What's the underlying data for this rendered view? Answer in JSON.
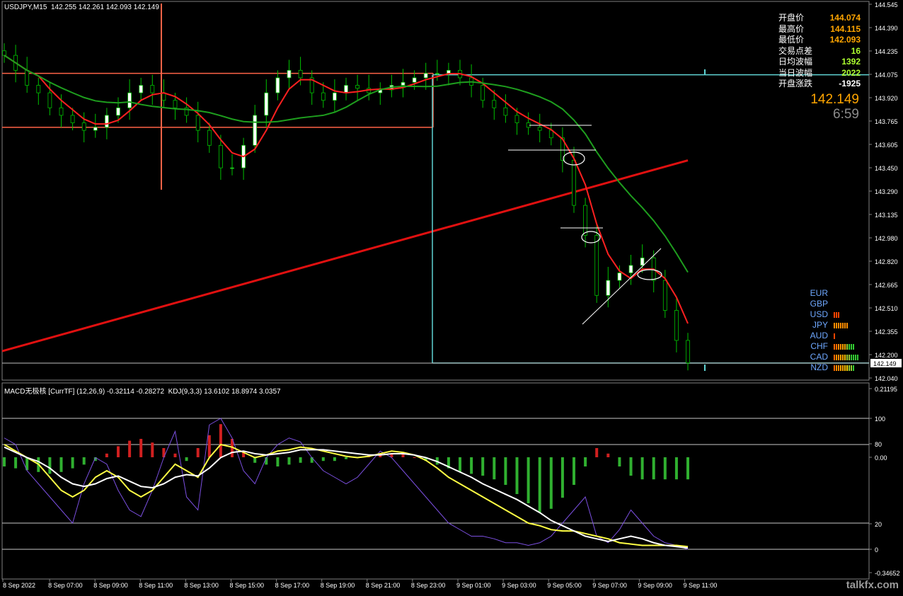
{
  "header": {
    "symbol_line": "USDJPY,M15  142.255 142.261 142.093 142.149"
  },
  "hud": {
    "rows": [
      {
        "key": "开盘价",
        "value": "144.074",
        "color": "#ffa500"
      },
      {
        "key": "最高价",
        "value": "144.115",
        "color": "#ffa500"
      },
      {
        "key": "最低价",
        "value": "142.093",
        "color": "#ffa500"
      },
      {
        "key": "交易点差",
        "value": "16",
        "color": "#adff2f"
      },
      {
        "key": "日均波幅",
        "value": "1392",
        "color": "#adff2f"
      },
      {
        "key": "当日波幅",
        "value": "2022",
        "color": "#adff2f"
      },
      {
        "key": "开盘涨跌",
        "value": "-1925",
        "color": "#ffffff"
      }
    ],
    "big_price": "142.149",
    "timer": "6:59"
  },
  "currency_strength": [
    {
      "name": "EUR",
      "bars": []
    },
    {
      "name": "GBP",
      "bars": []
    },
    {
      "name": "USD",
      "bars": [
        "#ff4500",
        "#ff4500",
        "#ff4500"
      ]
    },
    {
      "name": "JPY",
      "bars": [
        "#ff8c00",
        "#ff8c00",
        "#ff8c00",
        "#ff8c00",
        "#ff8c00",
        "#ff8c00",
        "#ff8c00"
      ]
    },
    {
      "name": "AUD",
      "bars": [
        "#ff4500"
      ]
    },
    {
      "name": "CHF",
      "bars": [
        "#ff6a00",
        "#ff6a00",
        "#ff8c00",
        "#ff8c00",
        "#ffa500",
        "#ffa500",
        "#9acd32",
        "#32cd32",
        "#32cd32",
        "#32cd32"
      ]
    },
    {
      "name": "CAD",
      "bars": [
        "#ff6a00",
        "#ff8c00",
        "#ff8c00",
        "#ffa500",
        "#ffa500",
        "#ffc000",
        "#9acd32",
        "#9acd32",
        "#32cd32",
        "#32cd32",
        "#32cd32",
        "#32cd32"
      ]
    },
    {
      "name": "NZD",
      "bars": [
        "#ff6a00",
        "#ff8c00",
        "#ff8c00",
        "#ffa500",
        "#ffa500",
        "#ffc000",
        "#ffd700",
        "#9acd32",
        "#9acd32",
        "#32cd32"
      ]
    }
  ],
  "price_axis": {
    "ticks": [
      "144.545",
      "144.390",
      "144.235",
      "144.075",
      "143.920",
      "143.765",
      "143.605",
      "143.450",
      "143.290",
      "143.135",
      "142.980",
      "142.820",
      "142.665",
      "142.510",
      "142.355",
      "142.200",
      "142.040"
    ],
    "current_price_label": "142.149"
  },
  "indicator": {
    "title": "MACD无极核 [CurrTF] (12,26,9) -0.32114 -0.28272  KDJ(9,3,3) 13.6102 18.8974 3.0357",
    "axis_ticks": [
      "0.21195",
      "100",
      "80",
      "0.00",
      "20",
      "0",
      "-0.34652"
    ]
  },
  "time_axis": {
    "labels": [
      "8 Sep 2022",
      "8 Sep 07:00",
      "8 Sep 09:00",
      "8 Sep 11:00",
      "8 Sep 13:00",
      "8 Sep 15:00",
      "8 Sep 17:00",
      "8 Sep 19:00",
      "8 Sep 21:00",
      "8 Sep 23:00",
      "9 Sep 01:00",
      "9 Sep 03:00",
      "9 Sep 05:00",
      "9 Sep 07:00",
      "9 Sep 09:00",
      "9 Sep 11:00"
    ]
  },
  "watermark": "talkfx.com",
  "colors": {
    "background": "#000000",
    "bull_candle": "#ffffff",
    "wick": "#00c000",
    "ma_fast": "#ff2020",
    "ma_slow": "#1e9e1e",
    "ma_long": "#e01010",
    "range_box": "#ff6347",
    "cyan_line": "#5fd3d3",
    "macd_up": "#d02020",
    "macd_down": "#30b030",
    "k_line": "#ffff44",
    "d_line": "#ffffff",
    "j_line": "#7b4fe0"
  },
  "chart_data": {
    "type": "candlestick",
    "symbol": "USDJPY",
    "timeframe": "M15",
    "ohlc_last": {
      "open": 142.255,
      "high": 142.261,
      "low": 142.093,
      "close": 142.149
    },
    "ylim": [
      142.04,
      144.545
    ],
    "day_open": 144.074,
    "day_high": 144.115,
    "day_low": 142.093,
    "close_path": [
      144.2,
      144.1,
      144.0,
      143.95,
      143.85,
      143.8,
      143.75,
      143.7,
      143.72,
      143.8,
      143.85,
      143.95,
      144.0,
      143.95,
      143.9,
      143.85,
      143.8,
      143.7,
      143.6,
      143.45,
      143.45,
      143.6,
      143.8,
      143.95,
      144.05,
      144.1,
      144.05,
      143.95,
      143.9,
      143.95,
      144.0,
      143.98,
      143.95,
      143.97,
      144.0,
      144.02,
      144.05,
      144.08,
      144.08,
      144.1,
      144.05,
      144.0,
      143.9,
      143.85,
      143.8,
      143.75,
      143.72,
      143.7,
      143.65,
      143.5,
      143.2,
      143.0,
      142.6,
      142.7,
      142.75,
      142.8,
      142.85,
      142.7,
      142.5,
      142.3,
      142.15
    ],
    "macd_histogram": [
      -0.05,
      -0.06,
      -0.07,
      -0.08,
      -0.09,
      -0.08,
      -0.06,
      -0.04,
      -0.02,
      0.02,
      0.06,
      0.09,
      0.1,
      0.08,
      0.05,
      0.02,
      -0.02,
      0.05,
      0.12,
      0.18,
      0.1,
      0.03,
      -0.03,
      -0.04,
      -0.05,
      -0.04,
      -0.03,
      -0.03,
      -0.02,
      -0.02,
      -0.01,
      0.0,
      0.01,
      0.02,
      0.02,
      0.02,
      0.0,
      -0.02,
      -0.04,
      -0.06,
      -0.08,
      -0.09,
      -0.1,
      -0.12,
      -0.15,
      -0.2,
      -0.25,
      -0.3,
      -0.28,
      -0.22,
      -0.15,
      -0.05,
      0.05,
      0.02,
      -0.05,
      -0.1,
      -0.12,
      -0.12,
      -0.12,
      -0.12,
      -0.12
    ],
    "kdj": {
      "k": [
        80,
        75,
        70,
        65,
        55,
        45,
        40,
        45,
        55,
        60,
        55,
        45,
        40,
        45,
        55,
        65,
        60,
        55,
        70,
        80,
        78,
        74,
        70,
        72,
        75,
        76,
        78,
        77,
        75,
        73,
        71,
        70,
        71,
        73,
        75,
        74,
        72,
        68,
        62,
        55,
        50,
        45,
        40,
        35,
        30,
        25,
        20,
        18,
        15,
        14,
        14,
        12,
        10,
        8,
        5,
        4,
        3,
        3,
        3,
        3,
        2
      ],
      "d": [
        78,
        74,
        70,
        67,
        62,
        55,
        50,
        48,
        50,
        54,
        56,
        52,
        48,
        47,
        50,
        55,
        57,
        56,
        62,
        70,
        74,
        75,
        73,
        72,
        73,
        74,
        76,
        76,
        76,
        75,
        74,
        73,
        72,
        72,
        73,
        73,
        72,
        70,
        67,
        63,
        59,
        55,
        50,
        46,
        42,
        38,
        33,
        28,
        22,
        18,
        14,
        10,
        8,
        6,
        8,
        10,
        8,
        5,
        3,
        2,
        1
      ],
      "j": [
        85,
        80,
        60,
        50,
        40,
        30,
        20,
        50,
        70,
        65,
        45,
        30,
        25,
        45,
        70,
        90,
        40,
        30,
        95,
        100,
        85,
        60,
        50,
        70,
        80,
        85,
        82,
        70,
        60,
        55,
        50,
        55,
        65,
        75,
        70,
        60,
        50,
        40,
        30,
        20,
        15,
        10,
        10,
        8,
        5,
        5,
        3,
        5,
        10,
        20,
        30,
        40,
        10,
        5,
        15,
        30,
        20,
        10,
        5,
        3,
        0
      ],
      "levels": [
        100,
        80,
        20,
        0
      ]
    }
  }
}
